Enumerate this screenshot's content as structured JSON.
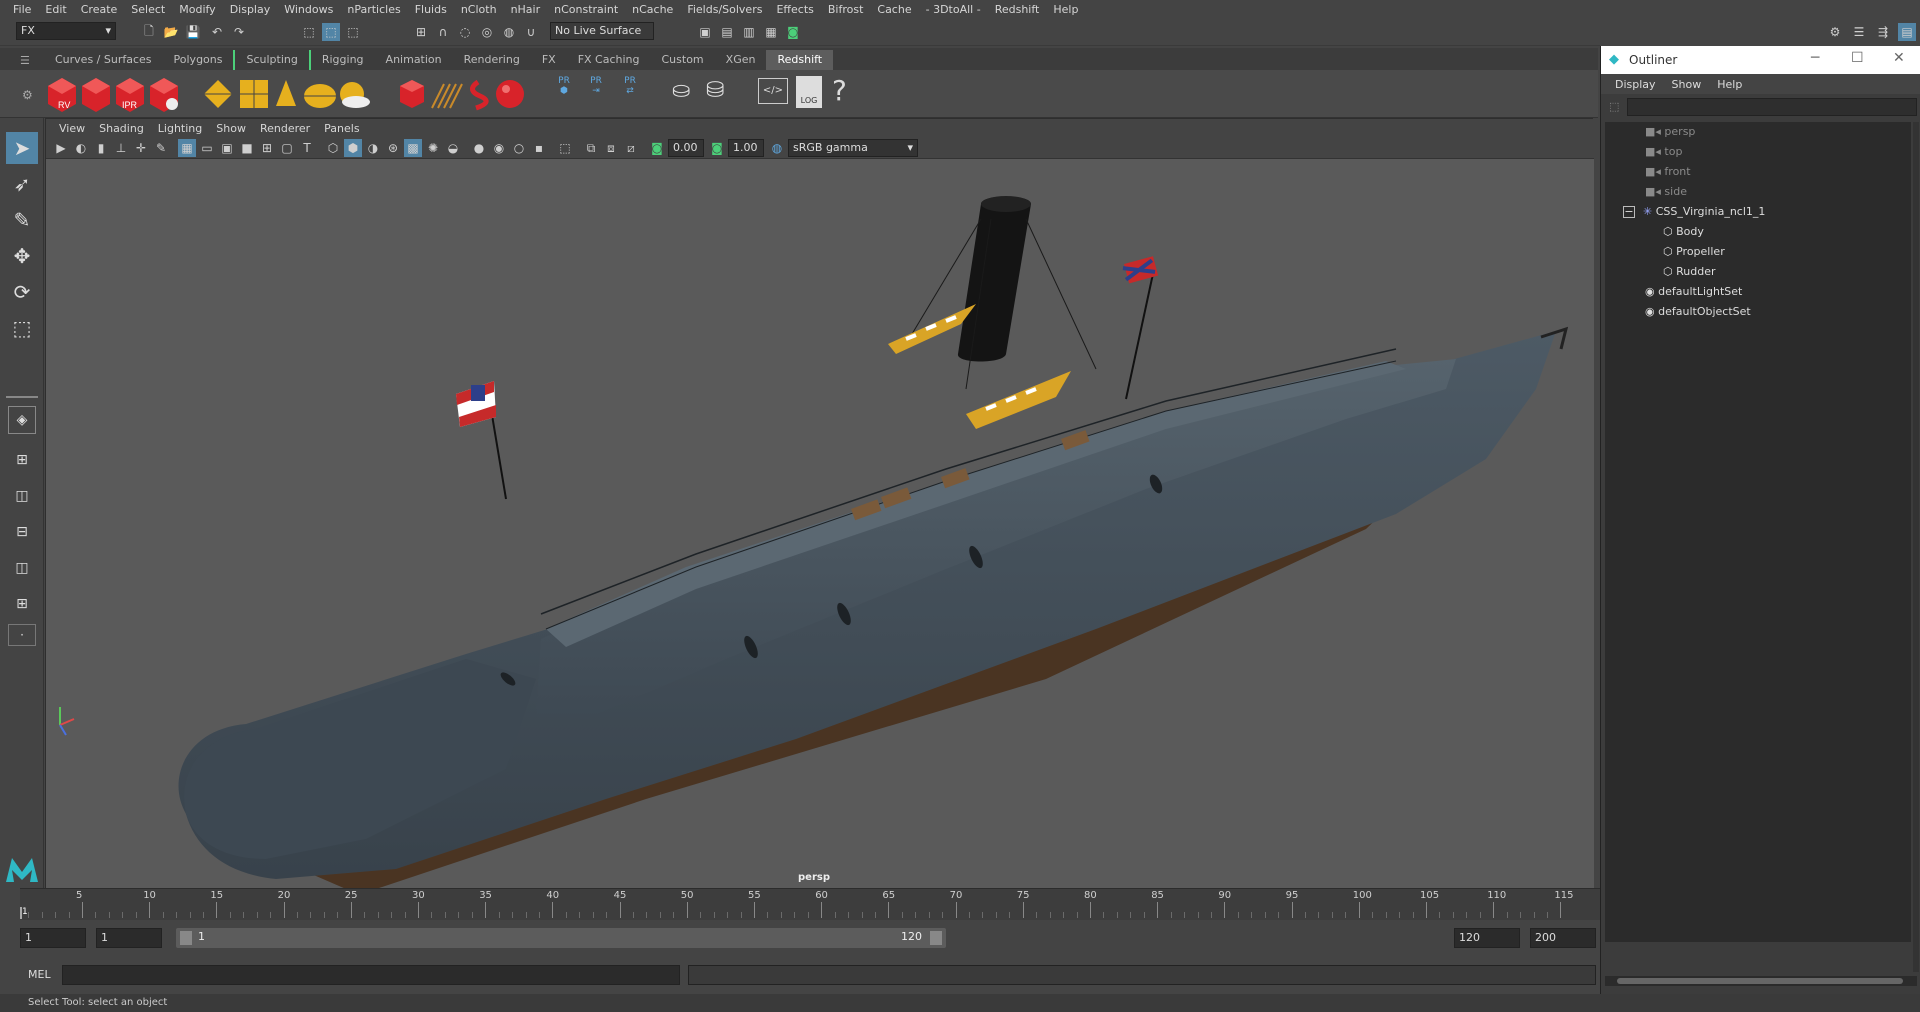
{
  "menubar": {
    "items": [
      "File",
      "Edit",
      "Create",
      "Select",
      "Modify",
      "Display",
      "Windows",
      "nParticles",
      "Fluids",
      "nCloth",
      "nHair",
      "nConstraint",
      "nCache",
      "Fields/Solvers",
      "Effects",
      "Bifrost",
      "Cache",
      "- 3DtoAll -",
      "Redshift",
      "Help"
    ]
  },
  "statusline": {
    "mode": "FX",
    "live_surface": "No Live Surface"
  },
  "shelf": {
    "tabs": [
      "Curves / Surfaces",
      "Polygons",
      "Sculpting",
      "Rigging",
      "Animation",
      "Rendering",
      "FX",
      "FX Caching",
      "Custom",
      "XGen",
      "Redshift"
    ],
    "active_tab": "Redshift",
    "rv_label": "RV",
    "ipr_label": "IPR",
    "pr_label": "PR",
    "log_label": "LOG",
    "help_glyph": "?"
  },
  "viewport": {
    "menu": [
      "View",
      "Shading",
      "Lighting",
      "Show",
      "Renderer",
      "Panels"
    ],
    "exposure": "0.00",
    "gamma": "1.00",
    "color_space": "sRGB gamma",
    "camera_label": "persp"
  },
  "timeline": {
    "ticks": [
      "5",
      "10",
      "15",
      "20",
      "25",
      "30",
      "35",
      "40",
      "45",
      "50",
      "55",
      "60",
      "65",
      "70",
      "75",
      "80",
      "85",
      "90",
      "95",
      "100",
      "105",
      "110",
      "115"
    ],
    "current_frame": "1"
  },
  "range": {
    "start": "1",
    "playback_start": "1",
    "slider_start": "1",
    "slider_end": "120",
    "playback_end": "120",
    "end": "200"
  },
  "cmdline": {
    "label": "MEL"
  },
  "helpline": {
    "text": "Select Tool: select an object"
  },
  "outliner": {
    "title": "Outliner",
    "menu": [
      "Display",
      "Show",
      "Help"
    ],
    "items": [
      {
        "label": "persp",
        "dim": true,
        "indent": 1,
        "icon": "camera"
      },
      {
        "label": "top",
        "dim": true,
        "indent": 1,
        "icon": "camera"
      },
      {
        "label": "front",
        "dim": true,
        "indent": 1,
        "icon": "camera"
      },
      {
        "label": "side",
        "dim": true,
        "indent": 1,
        "icon": "camera"
      },
      {
        "label": "CSS_Virginia_ncl1_1",
        "dim": false,
        "indent": 1,
        "icon": "group"
      },
      {
        "label": "Body",
        "dim": false,
        "indent": 2,
        "icon": "mesh"
      },
      {
        "label": "Propeller",
        "dim": false,
        "indent": 2,
        "icon": "mesh"
      },
      {
        "label": "Rudder",
        "dim": false,
        "indent": 2,
        "icon": "mesh"
      },
      {
        "label": "defaultLightSet",
        "dim": false,
        "indent": 1,
        "icon": "set"
      },
      {
        "label": "defaultObjectSet",
        "dim": false,
        "indent": 1,
        "icon": "set"
      }
    ]
  },
  "colors": {
    "panel": "#444444",
    "viewport_bg": "#5a5a5a",
    "hull": "#3f4a54",
    "lifeboat": "#d9a426",
    "redshift_red": "#d8232a"
  }
}
